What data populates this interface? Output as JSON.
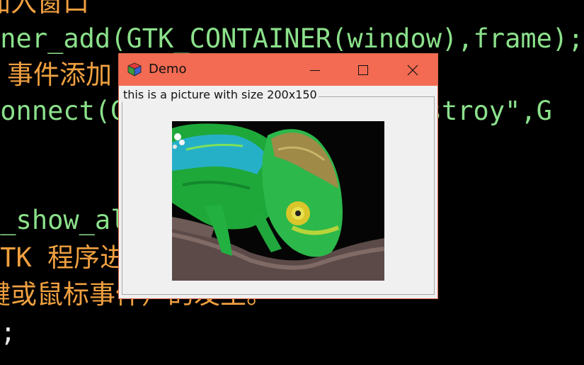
{
  "background_code": {
    "lines": [
      {
        "text": "加入窗口",
        "color": "orange"
      },
      {
        "text": "iner_add(GTK_CONTAINER(window),frame);",
        "color": "green"
      },
      {
        "text": "事件添加",
        "color": "orange"
      },
      {
        "text": "connect(G_OBJECT(window),\"destroy\",G",
        "color": "green"
      },
      {
        "text": "",
        "color": "green"
      },
      {
        "text": "t_show_all(window);",
        "color": "green"
      },
      {
        "text": "GTK 程序进入 gtk_main() 函数。",
        "color": "orange"
      },
      {
        "text": "键或鼠标事件）的发生。",
        "color": "orange"
      },
      {
        "text": ");",
        "color": "white"
      }
    ]
  },
  "window": {
    "title": "Demo",
    "frame_label": "this is a picture with size 200x150",
    "picture": {
      "alt": "chameleon picture",
      "icon": "chameleon-image"
    },
    "controls": {
      "minimize": "minimize-icon",
      "maximize": "maximize-icon",
      "close": "close-icon"
    },
    "colors": {
      "titlebar": "#f26b52",
      "body": "#f0f0f0",
      "border": "#d9674a"
    }
  }
}
